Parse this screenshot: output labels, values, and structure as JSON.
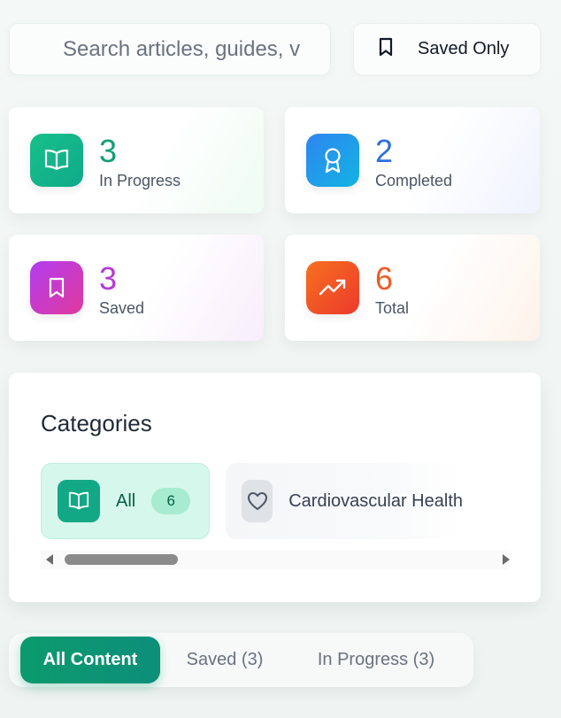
{
  "search": {
    "placeholder": "Search articles, guides, v"
  },
  "saved_only": {
    "label": "Saved Only"
  },
  "stats": [
    {
      "value": "3",
      "label": "In Progress",
      "icon": "book-open-icon",
      "color": "#0f9f76"
    },
    {
      "value": "2",
      "label": "Completed",
      "icon": "award-icon",
      "color": "#2d6fe0"
    },
    {
      "value": "3",
      "label": "Saved",
      "icon": "bookmark-icon",
      "color": "#b43ad6"
    },
    {
      "value": "6",
      "label": "Total",
      "icon": "trending-up-icon",
      "color": "#ee5a24"
    }
  ],
  "categories": {
    "title": "Categories",
    "items": [
      {
        "name": "All",
        "count": "6",
        "icon": "book-open-icon"
      },
      {
        "name": "Cardiovascular Health",
        "icon": "heart-icon"
      }
    ]
  },
  "tabs": [
    {
      "label": "All Content",
      "active": true
    },
    {
      "label": "Saved (3)",
      "active": false
    },
    {
      "label": "In Progress (3)",
      "active": false
    }
  ]
}
